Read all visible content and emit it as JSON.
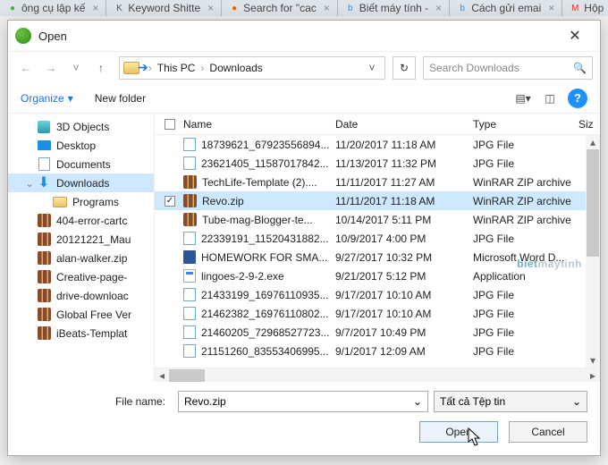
{
  "browser_tabs": [
    {
      "label": "ông cụ lập kế",
      "favicon": "●",
      "fav_color": "#4CAF50"
    },
    {
      "label": "Keyword Shitte",
      "favicon": "K",
      "fav_color": "#555"
    },
    {
      "label": "Search for \"cac",
      "favicon": "●",
      "fav_color": "#f06500"
    },
    {
      "label": "Biết máy tính -",
      "favicon": "b",
      "fav_color": "#2196F3"
    },
    {
      "label": "Cách gửi emai",
      "favicon": "b",
      "fav_color": "#2196F3"
    },
    {
      "label": "Hộp",
      "favicon": "M",
      "fav_color": "#D93025"
    }
  ],
  "dialog": {
    "title": "Open",
    "breadcrumbs": [
      "This PC",
      "Downloads"
    ],
    "search_placeholder": "Search Downloads",
    "organize_label": "Organize",
    "new_folder_label": "New folder"
  },
  "columns": {
    "name": "Name",
    "date": "Date",
    "type": "Type",
    "size": "Siz"
  },
  "nav_tree": [
    {
      "label": "3D Objects",
      "icon": "3d"
    },
    {
      "label": "Desktop",
      "icon": "desk"
    },
    {
      "label": "Documents",
      "icon": "doc"
    },
    {
      "label": "Downloads",
      "icon": "dl",
      "selected": true,
      "expanded": true
    },
    {
      "label": "Programs",
      "icon": "folder",
      "sub": true
    },
    {
      "label": "404-error-cartc",
      "icon": "zip"
    },
    {
      "label": "20121221_Mau",
      "icon": "zip"
    },
    {
      "label": "alan-walker.zip",
      "icon": "zip"
    },
    {
      "label": "Creative-page-",
      "icon": "zip"
    },
    {
      "label": "drive-downloac",
      "icon": "zip"
    },
    {
      "label": "Global Free Ver",
      "icon": "zip"
    },
    {
      "label": "iBeats-Templat",
      "icon": "zip"
    }
  ],
  "files": [
    {
      "name": "18739621_67923556894...",
      "date": "11/20/2017 11:18 AM",
      "type": "JPG File",
      "icon": "jpg"
    },
    {
      "name": "23621405_11587017842...",
      "date": "11/13/2017 11:32 PM",
      "type": "JPG File",
      "icon": "jpg"
    },
    {
      "name": "TechLife-Template (2)....",
      "date": "11/11/2017 11:27 AM",
      "type": "WinRAR ZIP archive",
      "icon": "zip"
    },
    {
      "name": "Revo.zip",
      "date": "11/11/2017 11:18 AM",
      "type": "WinRAR ZIP archive",
      "icon": "zip",
      "selected": true,
      "checked": true
    },
    {
      "name": "Tube-mag-Blogger-te...",
      "date": "10/14/2017 5:11 PM",
      "type": "WinRAR ZIP archive",
      "icon": "zip"
    },
    {
      "name": "22339191_11520431882...",
      "date": "10/9/2017 4:00 PM",
      "type": "JPG File",
      "icon": "jpg"
    },
    {
      "name": "HOMEWORK FOR SMA...",
      "date": "9/27/2017 10:32 PM",
      "type": "Microsoft Word D...",
      "icon": "doc"
    },
    {
      "name": "lingoes-2-9-2.exe",
      "date": "9/21/2017 5:12 PM",
      "type": "Application",
      "icon": "exe"
    },
    {
      "name": "21433199_16976110935...",
      "date": "9/17/2017 10:10 AM",
      "type": "JPG File",
      "icon": "jpg"
    },
    {
      "name": "21462382_16976110802...",
      "date": "9/17/2017 10:10 AM",
      "type": "JPG File",
      "icon": "jpg"
    },
    {
      "name": "21460205_72968527723...",
      "date": "9/7/2017 10:49 PM",
      "type": "JPG File",
      "icon": "jpg"
    },
    {
      "name": "21151260_83553406995...",
      "date": "9/1/2017 12:09 AM",
      "type": "JPG File",
      "icon": "jpg"
    }
  ],
  "filename_label": "File name:",
  "filename_value": "Revo.zip",
  "filetype_value": "Tất cả Tệp tin",
  "buttons": {
    "open": "Open",
    "cancel": "Cancel"
  },
  "watermark": {
    "a": "biet",
    "b": "maytinh"
  }
}
